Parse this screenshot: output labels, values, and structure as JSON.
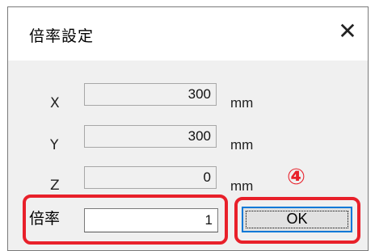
{
  "dialog": {
    "title": "倍率設定",
    "close_glyph": "✕"
  },
  "fields": [
    {
      "label": "X",
      "value": "300",
      "unit": "mm",
      "editable": false
    },
    {
      "label": "Y",
      "value": "300",
      "unit": "mm",
      "editable": false
    },
    {
      "label": "Z",
      "value": "0",
      "unit": "mm",
      "editable": false
    }
  ],
  "magnification": {
    "label": "倍率",
    "value": "1"
  },
  "ok_button": {
    "label": "OK"
  },
  "annotation": {
    "step_marker": "④",
    "highlight_color": "#e8202a"
  },
  "colors": {
    "focus_border": "#0078d7"
  }
}
